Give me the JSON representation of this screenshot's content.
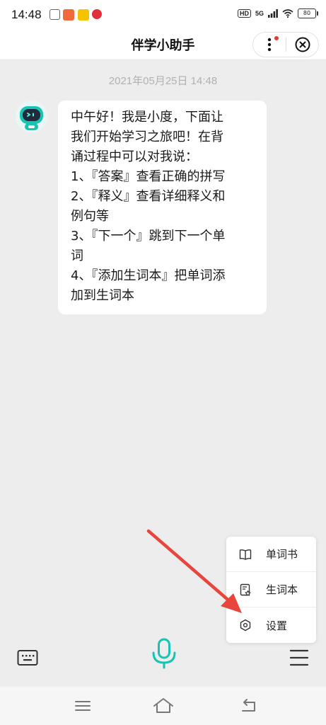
{
  "status_bar": {
    "time": "14:48",
    "hd": "HD",
    "network": "5G",
    "battery": "80"
  },
  "nav": {
    "title": "伴学小助手"
  },
  "chat": {
    "timestamp": "2021年05月25日 14:48",
    "message_lines": [
      "中午好！我是小度，下面让",
      "我们开始学习之旅吧！在背",
      "诵过程中可以对我说：",
      "1、『答案』查看正确的拼写",
      "2、『释义』查看详细释义和",
      "例句等",
      "3、『下一个』跳到下一个单",
      "词",
      "4、『添加生词本』把单词添",
      "加到生词本"
    ]
  },
  "popup_menu": {
    "items": [
      {
        "label": "单词书",
        "icon": "book-icon"
      },
      {
        "label": "生词本",
        "icon": "notebook-star-icon"
      },
      {
        "label": "设置",
        "icon": "settings-icon"
      }
    ]
  },
  "colors": {
    "accent": "#17c3b2",
    "arrow": "#e8453c",
    "notification_dot": "#e53935"
  }
}
